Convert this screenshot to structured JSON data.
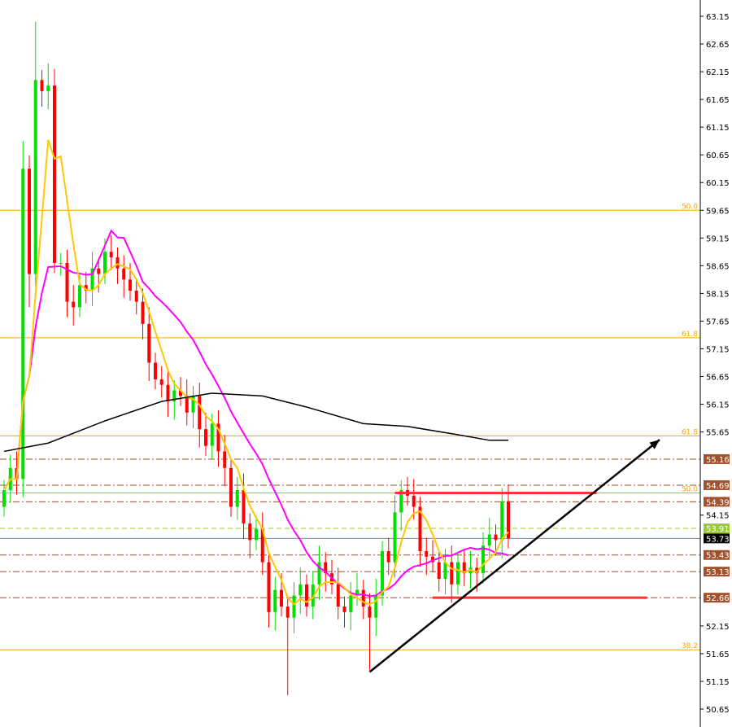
{
  "chart_data": {
    "type": "candlestick",
    "title": "",
    "ylim": [
      50.5,
      63.4
    ],
    "y_ticks": [
      63.15,
      62.65,
      62.15,
      61.65,
      61.15,
      60.65,
      60.15,
      59.65,
      59.15,
      58.65,
      58.15,
      57.65,
      57.15,
      56.65,
      56.15,
      55.65,
      54.15,
      52.15,
      51.65,
      51.15,
      50.65
    ],
    "closes": [
      54.6,
      55.0,
      54.8,
      60.4,
      58.5,
      62.0,
      61.8,
      61.9,
      58.7,
      58.7,
      58.0,
      57.9,
      58.3,
      58.2,
      58.6,
      58.5,
      58.9,
      58.8,
      58.6,
      58.4,
      58.2,
      58.0,
      57.6,
      56.9,
      56.6,
      56.5,
      56.2,
      56.4,
      56.3,
      56.0,
      56.3,
      55.7,
      55.4,
      55.8,
      55.3,
      55.0,
      54.3,
      54.6,
      54.0,
      53.7,
      53.9,
      53.3,
      52.4,
      52.8,
      52.5,
      52.3,
      52.7,
      52.9,
      52.5,
      52.9,
      53.3,
      53.1,
      52.9,
      52.5,
      52.4,
      52.7,
      52.8,
      52.5,
      52.3,
      52.7,
      53.5,
      53.3,
      54.2,
      54.6,
      54.5,
      54.3,
      53.5,
      53.4,
      53.3,
      53.0,
      53.3,
      52.9,
      53.3,
      53.1,
      53.2,
      53.1,
      53.6,
      53.8,
      53.7,
      54.4,
      53.73
    ],
    "first_open": 54.3,
    "high_overrides": {
      "3": 60.9,
      "5": 63.05,
      "7": 62.3
    },
    "low_overrides": {
      "4": 57.9,
      "45": 50.9,
      "58": 51.35
    },
    "fast_ma_period": 5,
    "mid_ma_period": 15,
    "slow_ma_points": [
      [
        0,
        55.3
      ],
      [
        7,
        55.45
      ],
      [
        16,
        55.85
      ],
      [
        25,
        56.2
      ],
      [
        33,
        56.35
      ],
      [
        41,
        56.3
      ],
      [
        48,
        56.1
      ],
      [
        57,
        55.8
      ],
      [
        64,
        55.75
      ],
      [
        72,
        55.6
      ],
      [
        77,
        55.5
      ],
      [
        80,
        55.5
      ]
    ],
    "fib_levels": [
      {
        "price": 59.65,
        "label": "50.0"
      },
      {
        "price": 57.35,
        "label": "61.8"
      },
      {
        "price": 55.58,
        "label": "61.8"
      },
      {
        "price": 54.55,
        "label": "50.0"
      },
      {
        "price": 51.72,
        "label": "38.2"
      }
    ],
    "price_levels": [
      {
        "price": 55.16,
        "label": "55.16"
      },
      {
        "price": 54.69,
        "label": "54.69"
      },
      {
        "price": 54.39,
        "label": "54.39"
      },
      {
        "price": 53.43,
        "label": "53.43"
      },
      {
        "price": 53.13,
        "label": "53.13"
      },
      {
        "price": 52.66,
        "label": "52.66"
      }
    ],
    "ask_level": {
      "price": 53.91,
      "label": "53.91"
    },
    "bid_level": {
      "price": 53.73,
      "label": "53.73"
    },
    "resistance": {
      "price": 54.55,
      "from_candle": 62,
      "to_candle": 94
    },
    "support": {
      "price": 52.66,
      "from_candle": 68,
      "to_candle": 102
    },
    "trendline": {
      "start": [
        58,
        51.32
      ],
      "end": [
        104,
        55.51
      ]
    },
    "colors": {
      "bull": "#00e000",
      "bear": "#ff0000",
      "fast_ma": "#ffc800",
      "mid_ma": "#ff00ff",
      "slow_ma": "#000000",
      "fib": "#ffa500",
      "level": "#a0522d",
      "ask": "#9acd32",
      "bid": "#778899",
      "zone": "#ff3333"
    }
  }
}
